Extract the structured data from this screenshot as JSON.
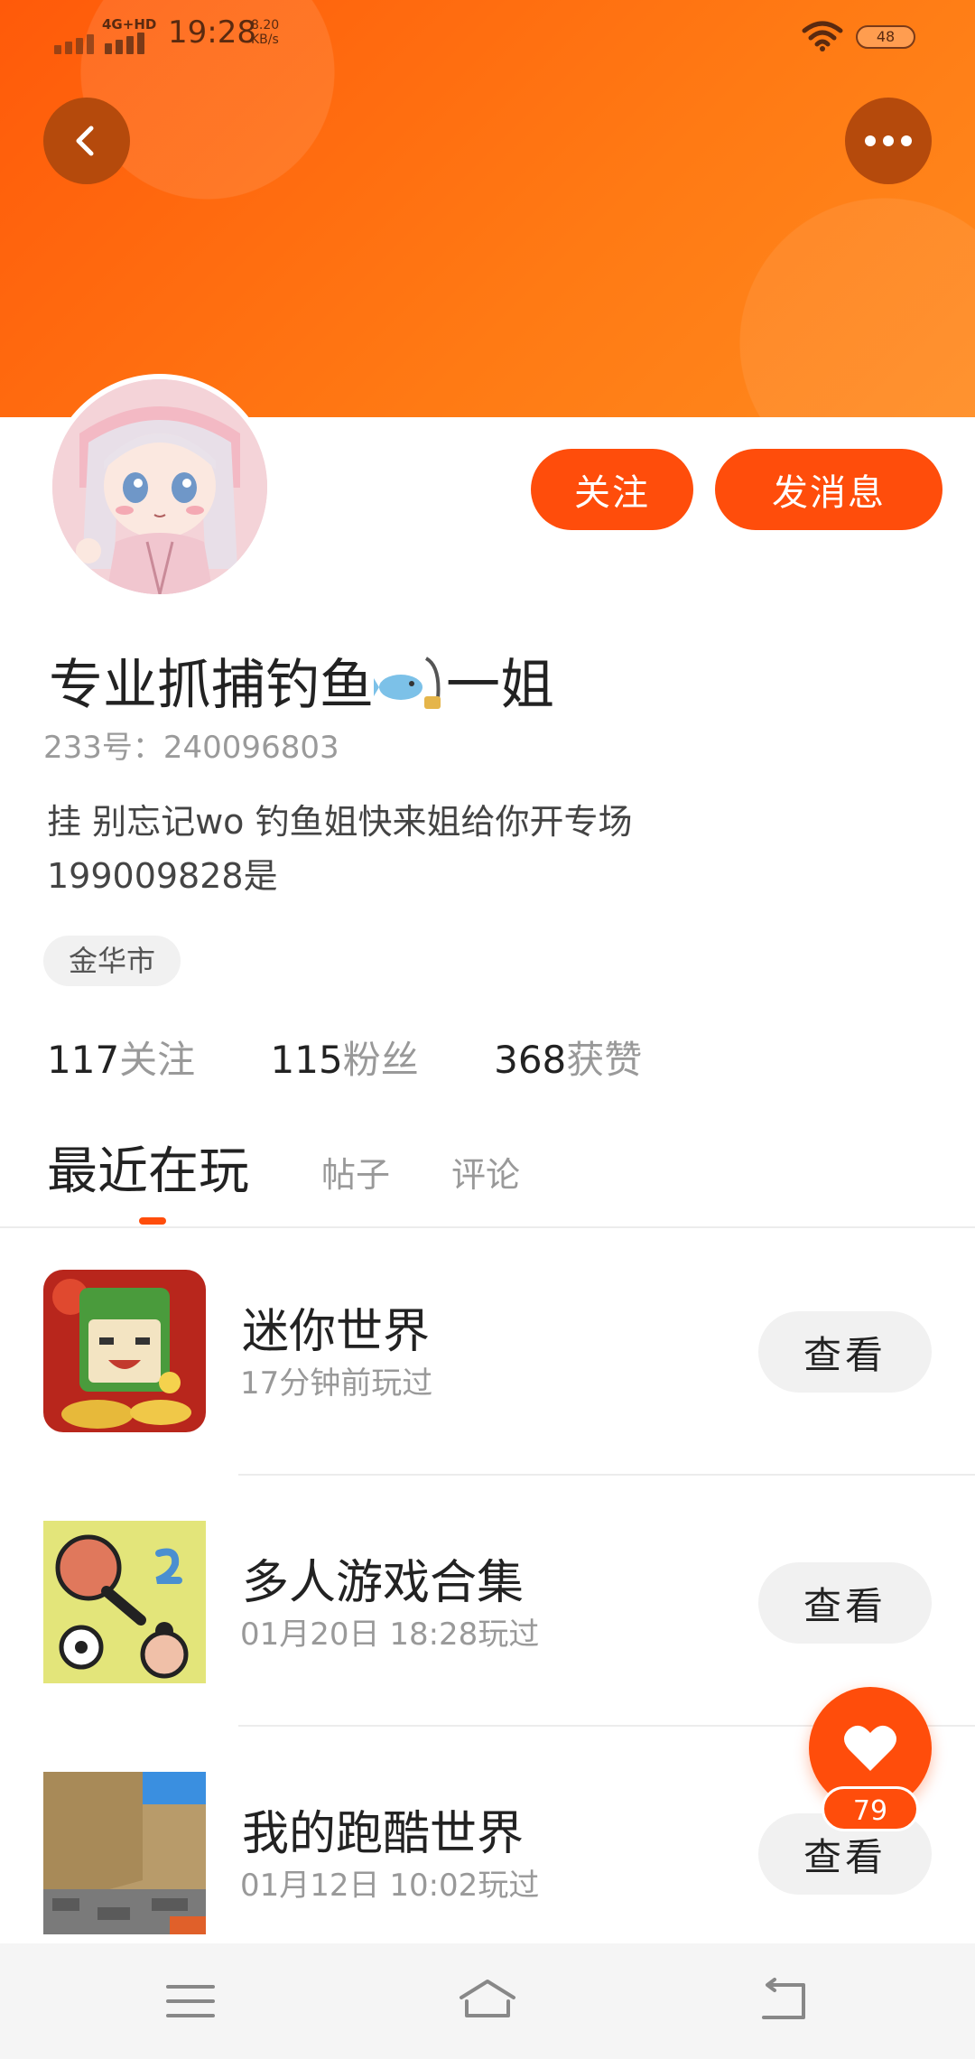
{
  "status_bar": {
    "network": "4G+HD",
    "time": "19:28",
    "speed_value": "8.20",
    "speed_unit": "KB/s",
    "battery": "48"
  },
  "header": {
    "back_icon": "chevron-left-icon",
    "more_icon": "more-dots-icon",
    "accent_color": "#ff5a0a"
  },
  "profile": {
    "avatar": "anime-girl-avatar",
    "follow_label": "关注",
    "message_label": "发消息",
    "name": "专业抓捕钓鱼",
    "name_suffix": "一姐",
    "name_emoji": "fishing-rod-emoji",
    "id_label": "233号：",
    "id_value": "240096803",
    "bio_line1": "挂 别忘记wo 钓鱼姐快来姐给你开专场",
    "bio_line2": "199009828是",
    "location": "金华市",
    "stats": [
      {
        "num": "117",
        "label": "关注"
      },
      {
        "num": "115",
        "label": "粉丝"
      },
      {
        "num": "368",
        "label": "获赞"
      }
    ]
  },
  "tabs": {
    "active": "最近在玩",
    "posts": "帖子",
    "comments": "评论"
  },
  "games": [
    {
      "title": "迷你世界",
      "time": "17分钟前玩过",
      "button": "查看",
      "icon": "mini-world-icon"
    },
    {
      "title": "多人游戏合集",
      "time": "01月20日 18:28玩过",
      "button": "查看",
      "icon": "multiplayer-games-icon"
    },
    {
      "title": "我的跑酷世界",
      "time": "01月12日 10:02玩过",
      "button": "查看",
      "icon": "parkour-world-icon"
    }
  ],
  "like": {
    "icon": "heart-icon",
    "count": "79"
  },
  "navbar": {
    "menu_icon": "menu-icon",
    "home_icon": "home-icon",
    "back_icon": "back-arrow-icon"
  }
}
